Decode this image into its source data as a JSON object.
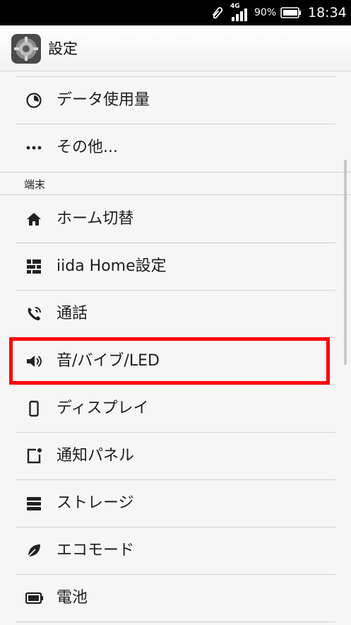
{
  "status_bar": {
    "network": "4G",
    "battery_percent": "90%",
    "time": "18:34",
    "icons": [
      "paperclip-icon",
      "signal-icon",
      "battery-icon"
    ]
  },
  "app_bar": {
    "title": "設定",
    "icon": "settings-gear-icon"
  },
  "list": {
    "items_top": [
      {
        "label": "データ使用量",
        "icon": "data-usage-icon"
      },
      {
        "label": "その他...",
        "icon": "more-dots-icon"
      }
    ],
    "section_header": "端末",
    "items_device": [
      {
        "label": "ホーム切替",
        "icon": "home-icon"
      },
      {
        "label": "iida Home設定",
        "icon": "grid-icon"
      },
      {
        "label": "通話",
        "icon": "phone-icon"
      },
      {
        "label": "音/バイブ/LED",
        "icon": "speaker-icon",
        "highlighted": true
      },
      {
        "label": "ディスプレイ",
        "icon": "display-icon"
      },
      {
        "label": "通知パネル",
        "icon": "notification-panel-icon"
      },
      {
        "label": "ストレージ",
        "icon": "storage-icon"
      },
      {
        "label": "エコモード",
        "icon": "leaf-icon"
      },
      {
        "label": "電池",
        "icon": "battery-icon"
      }
    ]
  },
  "highlight_color": "#ff0000"
}
